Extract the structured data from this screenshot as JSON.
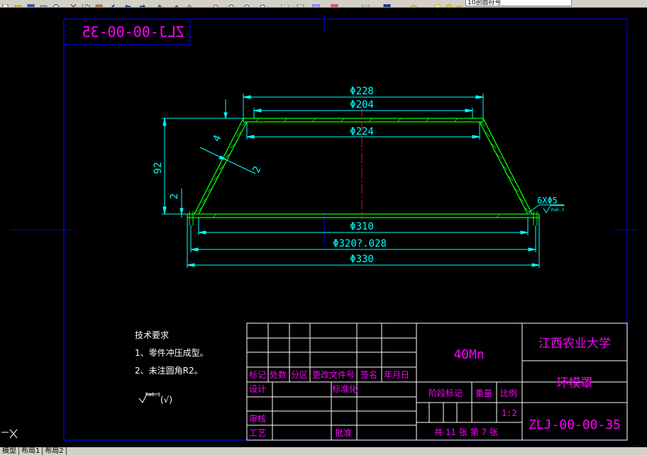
{
  "toolbar": {
    "icons": [
      "new-icon",
      "open-icon",
      "save-icon",
      "print-icon",
      "preview-icon",
      "cut-icon",
      "copy-icon",
      "paste-icon",
      "match-properties-icon",
      "undo-icon",
      "redo-icon",
      "pan-icon",
      "zoom-realtime-icon",
      "zoom-window-icon",
      "zoom-previous-icon",
      "properties-icon",
      "design-center-icon",
      "tool-palette-icon",
      "sheet-set-icon",
      "markup-icon",
      "calculator-icon",
      "help-icon",
      "layer-manager-icon",
      "layer-state-icon"
    ],
    "layer_value": "10剖面符号"
  },
  "drawing": {
    "mirrored_code": "ZLJ-00-00-35",
    "dims": {
      "d228": "Φ228",
      "d204": "Φ204",
      "d224": "Φ224",
      "d310": "Φ310",
      "d320": "Φ320?.028",
      "d330": "Φ330",
      "h92": "92",
      "h2": "2",
      "t4": "4",
      "t2": "2",
      "holes": "6XΦ5",
      "hole_rough": "Ra6.3"
    },
    "tech": {
      "title": "技术要求",
      "line1": "1、零件冲压成型。",
      "line2": "2、未注圆角R2。",
      "rough": "Ra6.3",
      "rough_suffix": "(√)"
    },
    "title_block": {
      "marks": "标记",
      "count": "处数",
      "zone": "分区",
      "doc": "更改文件号",
      "sign": "签名",
      "date": "年月日",
      "design": "设计",
      "std": "标准化",
      "review": "审核",
      "process": "工艺",
      "approve": "批准",
      "stage": "阶段标记",
      "weight": "重量",
      "scale_label": "比例",
      "scale": "1:2",
      "sheets": "共 11 张 第 7 张",
      "material": "40Mn",
      "school": "江西农业大学",
      "part_name": "环模罩",
      "code": "ZLJ-00-00-35"
    }
  },
  "tabs": [
    "模型",
    "布局1",
    "布局2"
  ],
  "colors": {
    "frame": "#0000ff",
    "cyan": "#00ffff",
    "green": "#00ff00",
    "magenta": "#ff00ff",
    "yellow": "#ffff00",
    "white": "#ffffff",
    "center": "#ff0000"
  }
}
